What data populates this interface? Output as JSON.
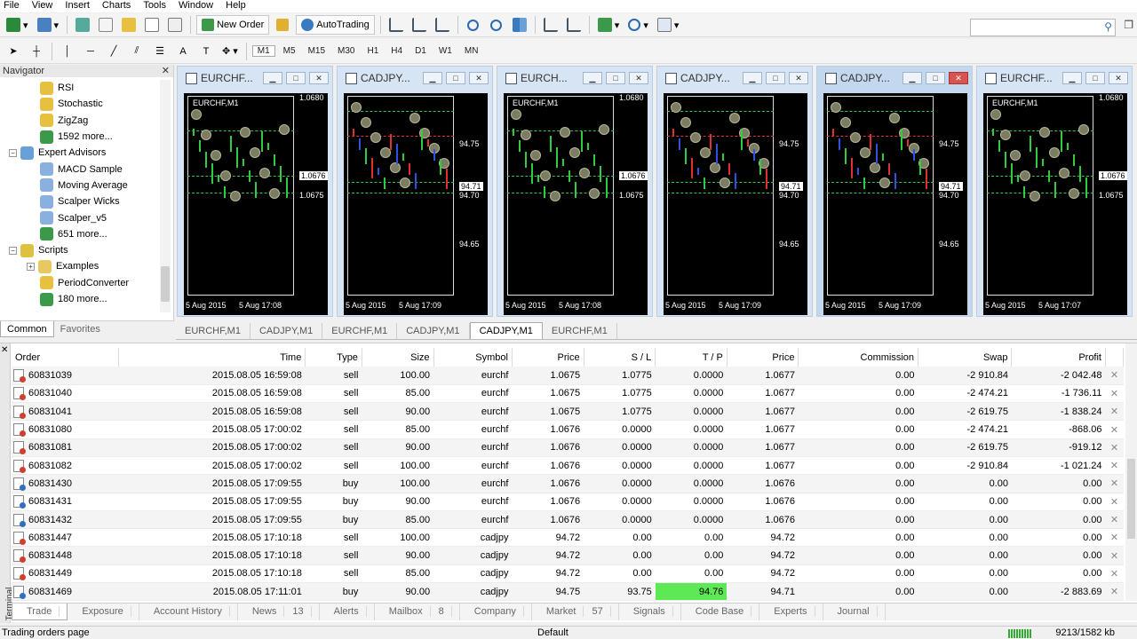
{
  "menu": [
    "File",
    "View",
    "Insert",
    "Charts",
    "Tools",
    "Window",
    "Help"
  ],
  "toolbar": {
    "new_order": "New Order",
    "autotrading": "AutoTrading",
    "timeframes": [
      "M1",
      "M5",
      "M15",
      "M30",
      "H1",
      "H4",
      "D1",
      "W1",
      "MN"
    ]
  },
  "navigator": {
    "title": "Navigator",
    "items": [
      {
        "label": "RSI",
        "icon": "indicator-icon"
      },
      {
        "label": "Stochastic",
        "icon": "indicator-icon"
      },
      {
        "label": "ZigZag",
        "icon": "indicator-icon"
      },
      {
        "label": "1592 more...",
        "icon": "globe-icon"
      },
      {
        "label": "Expert Advisors",
        "icon": "expert-folder-icon"
      },
      {
        "label": "MACD Sample",
        "icon": "expert-icon"
      },
      {
        "label": "Moving Average",
        "icon": "expert-icon"
      },
      {
        "label": "Scalper Wicks",
        "icon": "expert-icon"
      },
      {
        "label": "Scalper_v5",
        "icon": "expert-icon"
      },
      {
        "label": "651 more...",
        "icon": "globe-icon"
      },
      {
        "label": "Scripts",
        "icon": "script-folder-icon"
      },
      {
        "label": "Examples",
        "icon": "folder-icon"
      },
      {
        "label": "PeriodConverter",
        "icon": "script-icon"
      },
      {
        "label": "180 more...",
        "icon": "globe-icon"
      }
    ],
    "tabs": [
      "Common",
      "Favorites"
    ]
  },
  "charts": [
    {
      "title": "EURCHF...",
      "symbol": "EURCHF,M1",
      "prices": [
        "1.0680",
        "1.0676",
        "1.0675"
      ],
      "dates": [
        "5 Aug 2015",
        "5 Aug 17:08"
      ]
    },
    {
      "title": "CADJPY...",
      "symbol": "",
      "prices": [
        "94.75",
        "94.71",
        "94.70",
        "94.65"
      ],
      "dates": [
        "5 Aug 2015",
        "5 Aug 17:09"
      ]
    },
    {
      "title": "EURCH...",
      "symbol": "EURCHF,M1",
      "prices": [
        "1.0680",
        "1.0676",
        "1.0675"
      ],
      "dates": [
        "5 Aug 2015",
        "5 Aug 17:08"
      ]
    },
    {
      "title": "CADJPY...",
      "symbol": "",
      "prices": [
        "94.75",
        "94.71",
        "94.70",
        "94.65"
      ],
      "dates": [
        "5 Aug 2015",
        "5 Aug 17:09"
      ]
    },
    {
      "title": "CADJPY...",
      "symbol": "",
      "prices": [
        "94.75",
        "94.71",
        "94.70",
        "94.65"
      ],
      "dates": [
        "5 Aug 2015",
        "5 Aug 17:09"
      ]
    },
    {
      "title": "EURCHF...",
      "symbol": "EURCHF,M1",
      "prices": [
        "1.0680",
        "1.0676",
        "1.0675"
      ],
      "dates": [
        "5 Aug 2015",
        "5 Aug 17:07"
      ]
    }
  ],
  "chart_tabs": [
    "EURCHF,M1",
    "CADJPY,M1",
    "EURCHF,M1",
    "CADJPY,M1",
    "CADJPY,M1",
    "EURCHF,M1"
  ],
  "terminal": {
    "side_label": "Terminal",
    "columns": [
      "Order",
      "Time",
      "Type",
      "Size",
      "Symbol",
      "Price",
      "S / L",
      "T / P",
      "Price",
      "Commission",
      "Swap",
      "Profit"
    ],
    "rows": [
      [
        "60831039",
        "2015.08.05 16:59:08",
        "sell",
        "100.00",
        "eurchf",
        "1.0675",
        "1.0775",
        "0.0000",
        "1.0677",
        "0.00",
        "-2 910.84",
        "-2 042.48"
      ],
      [
        "60831040",
        "2015.08.05 16:59:08",
        "sell",
        "85.00",
        "eurchf",
        "1.0675",
        "1.0775",
        "0.0000",
        "1.0677",
        "0.00",
        "-2 474.21",
        "-1 736.11"
      ],
      [
        "60831041",
        "2015.08.05 16:59:08",
        "sell",
        "90.00",
        "eurchf",
        "1.0675",
        "1.0775",
        "0.0000",
        "1.0677",
        "0.00",
        "-2 619.75",
        "-1 838.24"
      ],
      [
        "60831080",
        "2015.08.05 17:00:02",
        "sell",
        "85.00",
        "eurchf",
        "1.0676",
        "0.0000",
        "0.0000",
        "1.0677",
        "0.00",
        "-2 474.21",
        "-868.06"
      ],
      [
        "60831081",
        "2015.08.05 17:00:02",
        "sell",
        "90.00",
        "eurchf",
        "1.0676",
        "0.0000",
        "0.0000",
        "1.0677",
        "0.00",
        "-2 619.75",
        "-919.12"
      ],
      [
        "60831082",
        "2015.08.05 17:00:02",
        "sell",
        "100.00",
        "eurchf",
        "1.0676",
        "0.0000",
        "0.0000",
        "1.0677",
        "0.00",
        "-2 910.84",
        "-1 021.24"
      ],
      [
        "60831430",
        "2015.08.05 17:09:55",
        "buy",
        "100.00",
        "eurchf",
        "1.0676",
        "0.0000",
        "0.0000",
        "1.0676",
        "0.00",
        "0.00",
        "0.00"
      ],
      [
        "60831431",
        "2015.08.05 17:09:55",
        "buy",
        "90.00",
        "eurchf",
        "1.0676",
        "0.0000",
        "0.0000",
        "1.0676",
        "0.00",
        "0.00",
        "0.00"
      ],
      [
        "60831432",
        "2015.08.05 17:09:55",
        "buy",
        "85.00",
        "eurchf",
        "1.0676",
        "0.0000",
        "0.0000",
        "1.0676",
        "0.00",
        "0.00",
        "0.00"
      ],
      [
        "60831447",
        "2015.08.05 17:10:18",
        "sell",
        "100.00",
        "cadjpy",
        "94.72",
        "0.00",
        "0.00",
        "94.72",
        "0.00",
        "0.00",
        "0.00"
      ],
      [
        "60831448",
        "2015.08.05 17:10:18",
        "sell",
        "90.00",
        "cadjpy",
        "94.72",
        "0.00",
        "0.00",
        "94.72",
        "0.00",
        "0.00",
        "0.00"
      ],
      [
        "60831449",
        "2015.08.05 17:10:18",
        "sell",
        "85.00",
        "cadjpy",
        "94.72",
        "0.00",
        "0.00",
        "94.72",
        "0.00",
        "0.00",
        "0.00"
      ],
      [
        "60831469",
        "2015.08.05 17:11:01",
        "buy",
        "90.00",
        "cadjpy",
        "94.75",
        "93.75",
        "94.76",
        "94.71",
        "0.00",
        "0.00",
        "-2 883.69"
      ]
    ],
    "tabs": [
      {
        "label": "Trade",
        "badge": ""
      },
      {
        "label": "Exposure",
        "badge": ""
      },
      {
        "label": "Account History",
        "badge": ""
      },
      {
        "label": "News",
        "badge": "13"
      },
      {
        "label": "Alerts",
        "badge": ""
      },
      {
        "label": "Mailbox",
        "badge": "8"
      },
      {
        "label": "Company",
        "badge": ""
      },
      {
        "label": "Market",
        "badge": "57"
      },
      {
        "label": "Signals",
        "badge": ""
      },
      {
        "label": "Code Base",
        "badge": ""
      },
      {
        "label": "Experts",
        "badge": ""
      },
      {
        "label": "Journal",
        "badge": ""
      }
    ]
  },
  "status": {
    "left": "Trading orders page",
    "profile": "Default",
    "memory": "9213/1582 kb"
  },
  "colors": {
    "tp_highlight": "#5fe855",
    "chart_bg": "#000000",
    "active_chart_close": "#d9534f"
  }
}
